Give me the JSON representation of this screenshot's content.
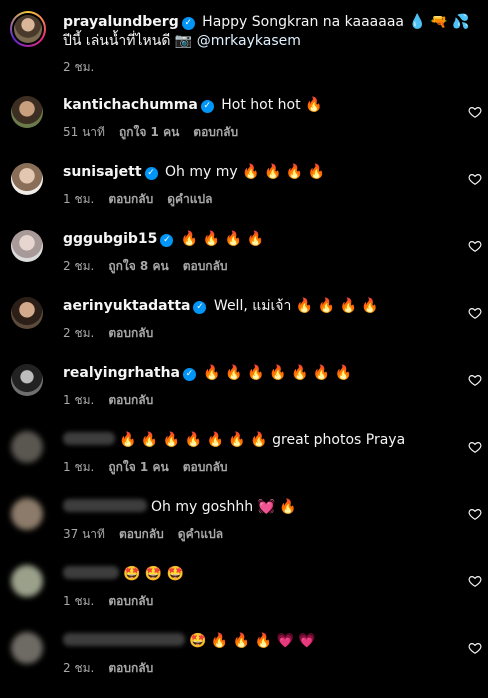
{
  "caption": {
    "username": "prayalundberg",
    "text": " Happy Songkran na kaaaaaa 💧 🔫 💦 ปีนี้ เล่นน้ำที่ไหนดี 📷 ",
    "mention": "@mrkaykasem",
    "time": "2 ชม."
  },
  "comments": [
    {
      "username": "kantichachumma",
      "verified": true,
      "text": " Hot hot hot 🔥",
      "time": "51 นาที",
      "likes": "ถูกใจ 1 คน",
      "reply": "ตอบกลับ",
      "translate": ""
    },
    {
      "username": "sunisajett",
      "verified": true,
      "text": " Oh my my 🔥 🔥 🔥 🔥",
      "time": "1 ชม.",
      "likes": "",
      "reply": "ตอบกลับ",
      "translate": "ดูคำแปล"
    },
    {
      "username": "gggubgib15",
      "verified": true,
      "text": " 🔥 🔥 🔥 🔥",
      "time": "2 ชม.",
      "likes": "ถูกใจ 8 คน",
      "reply": "ตอบกลับ",
      "translate": ""
    },
    {
      "username": "aerinyuktadatta",
      "verified": true,
      "text": " Well, แม่เจ้า 🔥 🔥 🔥 🔥",
      "time": "2 ชม.",
      "likes": "",
      "reply": "ตอบกลับ",
      "translate": ""
    },
    {
      "username": "realyingrhatha",
      "verified": true,
      "text": " 🔥 🔥 🔥 🔥 🔥 🔥 🔥",
      "time": "1 ชม.",
      "likes": "",
      "reply": "ตอบกลับ",
      "translate": ""
    },
    {
      "username": "",
      "verified": false,
      "text": "🔥 🔥 🔥 🔥 🔥 🔥 🔥 great photos Praya",
      "time": "1 ชม.",
      "likes": "ถูกใจ 1 คน",
      "reply": "ตอบกลับ",
      "translate": ""
    },
    {
      "username": "",
      "verified": false,
      "text": "Oh my goshhh 💓 🔥",
      "time": "37 นาที",
      "likes": "",
      "reply": "ตอบกลับ",
      "translate": "ดูคำแปล"
    },
    {
      "username": "",
      "verified": false,
      "text": "🤩 🤩 🤩",
      "time": "1 ชม.",
      "likes": "",
      "reply": "ตอบกลับ",
      "translate": ""
    },
    {
      "username": "",
      "verified": false,
      "text": "🤩 🔥 🔥 🔥 💗 💗",
      "time": "2 ชม.",
      "likes": "",
      "reply": "ตอบกลับ",
      "translate": ""
    }
  ],
  "colors": {
    "verified": "#0095f6",
    "meta": "#a8a8a8",
    "background": "#000000"
  },
  "icons": {
    "like": "heart-outline-icon",
    "verified": "verified-badge-icon"
  }
}
